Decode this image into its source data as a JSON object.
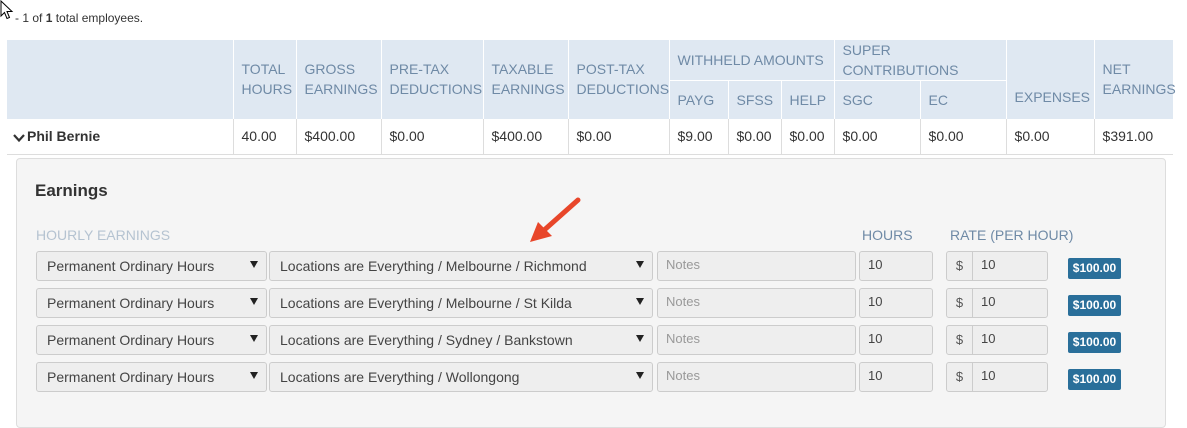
{
  "pager": {
    "prefix": " - 1 of ",
    "count": "1",
    "suffix": " total employees."
  },
  "summary": {
    "groups": {
      "withheld": "WITHHELD AMOUNTS",
      "super": "SUPER CONTRIBUTIONS"
    },
    "headers": {
      "total_hours": [
        "TOTAL",
        "HOURS"
      ],
      "gross": [
        "GROSS",
        "EARNINGS"
      ],
      "pretax": [
        "PRE-TAX",
        "DEDUCTIONS"
      ],
      "taxable": [
        "TAXABLE",
        "EARNINGS"
      ],
      "posttax": [
        "POST-TAX",
        "DEDUCTIONS"
      ],
      "payg": "PAYG",
      "sfss": "SFSS",
      "help": "HELP",
      "sgc": "SGC",
      "ec": "EC",
      "expenses": "EXPENSES",
      "net": [
        "NET",
        "EARNINGS"
      ]
    },
    "employee": {
      "name": "Phil Bernie",
      "total_hours": "40.00",
      "gross": "$400.00",
      "pretax": "$0.00",
      "taxable": "$400.00",
      "posttax": "$0.00",
      "payg": "$9.00",
      "sfss": "$0.00",
      "help": "$0.00",
      "sgc": "$0.00",
      "ec": "$0.00",
      "expenses": "$0.00",
      "net": "$391.00"
    }
  },
  "earnings": {
    "title": "Earnings",
    "labels": {
      "hourly": "HOURLY EARNINGS",
      "hours": "HOURS",
      "rate": "RATE (PER HOUR)"
    },
    "rows": [
      {
        "type": "Permanent Ordinary Hours",
        "location": "Locations are Everything / Melbourne / Richmond",
        "notes_placeholder": "Notes",
        "hours": "10",
        "currency": "$",
        "rate": "10",
        "total": "$100.00"
      },
      {
        "type": "Permanent Ordinary Hours",
        "location": "Locations are Everything / Melbourne / St Kilda",
        "notes_placeholder": "Notes",
        "hours": "10",
        "currency": "$",
        "rate": "10",
        "total": "$100.00"
      },
      {
        "type": "Permanent Ordinary Hours",
        "location": "Locations are Everything / Sydney / Bankstown",
        "notes_placeholder": "Notes",
        "hours": "10",
        "currency": "$",
        "rate": "10",
        "total": "$100.00"
      },
      {
        "type": "Permanent Ordinary Hours",
        "location": "Locations are Everything / Wollongong",
        "notes_placeholder": "Notes",
        "hours": "10",
        "currency": "$",
        "rate": "10",
        "total": "$100.00"
      }
    ]
  },
  "colors": {
    "header_bg": "#dfe8f2",
    "header_text": "#6f8aa6",
    "badge": "#2a6f9a",
    "arrow": "#e8462a"
  },
  "icons": {
    "cursor": "mouse-pointer-icon",
    "expand": "chevron-down-icon",
    "annotation": "red-arrow-icon",
    "dropdown": "caret-down-icon"
  }
}
